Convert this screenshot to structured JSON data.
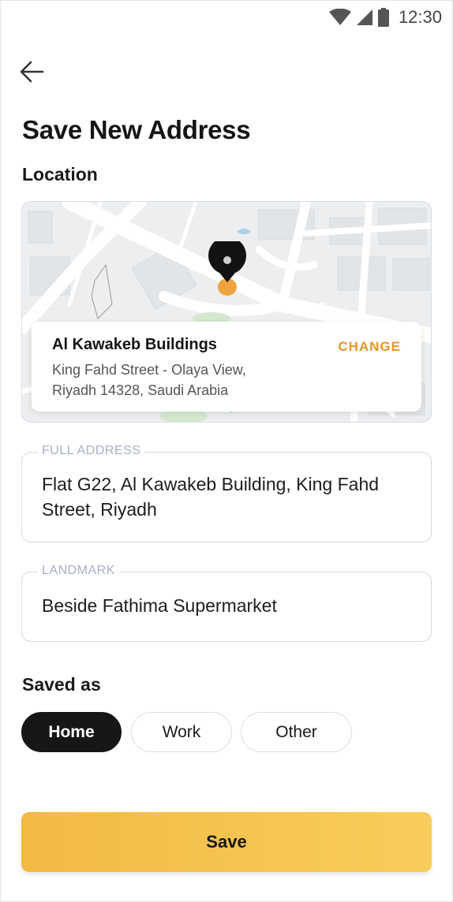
{
  "status_bar": {
    "time": "12:30"
  },
  "header": {
    "title": "Save New Address"
  },
  "location": {
    "section_label": "Location",
    "place_name": "Al Kawakeb Buildings",
    "change_label": "CHANGE",
    "address_line1": "King Fahd Street - Olaya View,",
    "address_line2": "Riyadh 14328, Saudi Arabia"
  },
  "full_address": {
    "label": "FULL ADDRESS",
    "line1": "Flat G22, Al Kawakeb Building, King Fahd",
    "line2": "Street, Riyadh"
  },
  "landmark": {
    "label": "LANDMARK",
    "value": "Beside Fathima Supermarket"
  },
  "saved_as": {
    "label": "Saved as",
    "options": [
      "Home",
      "Work",
      "Other"
    ],
    "selected": "Home"
  },
  "save_button": {
    "label": "Save"
  },
  "colors": {
    "accent": "#e8962a",
    "save_gradient_start": "#f3b943",
    "save_gradient_end": "#f8cd5c",
    "selected_chip": "#161616",
    "border": "#d6d9e6"
  }
}
